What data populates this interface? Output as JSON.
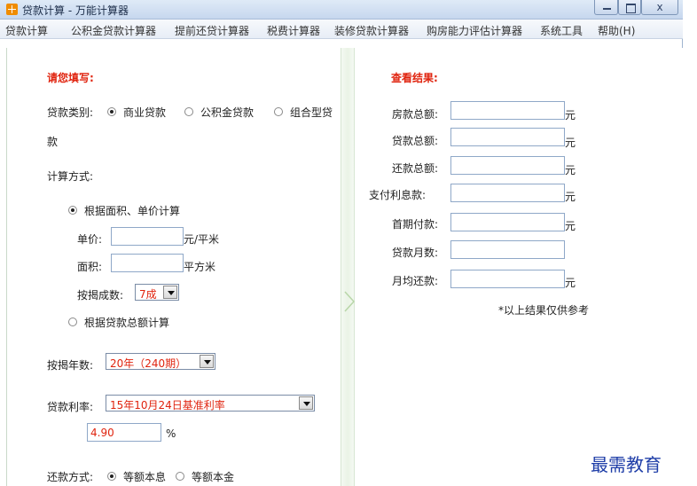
{
  "window": {
    "title": "贷款计算 - 万能计算器",
    "controls": {
      "close": "x"
    }
  },
  "menu": [
    "贷款计算",
    "公积金贷款计算器",
    "提前还贷计算器",
    "税费计算器",
    "装修贷款计算器",
    "购房能力评估计算器",
    "系统工具",
    "帮助(H)"
  ],
  "left": {
    "heading": "请您填写:",
    "loan_type": {
      "label": "贷款类别:",
      "options": [
        "商业贷款",
        "公积金贷款",
        "组合型贷款"
      ],
      "selected": "商业贷款",
      "wrap_tail": "款"
    },
    "calc_method": {
      "label": "计算方式:",
      "by_area": {
        "label": "根据面积、单价计算",
        "selected": true,
        "unit_price_label": "单价:",
        "unit_price_value": "",
        "unit_price_unit": "元/平米",
        "area_label": "面积:",
        "area_value": "",
        "area_unit": "平方米",
        "ratio_label": "按揭成数:",
        "ratio_value": "7成"
      },
      "by_total": {
        "label": "根据贷款总额计算",
        "selected": false
      }
    },
    "years": {
      "label": "按揭年数:",
      "value": "20年（240期）"
    },
    "rate": {
      "label": "贷款利率:",
      "value": "15年10月24日基准利率",
      "number": "4.90",
      "unit": "%"
    },
    "repay": {
      "label": "还款方式:",
      "options": [
        "等额本息",
        "等额本金"
      ],
      "selected": "等额本息"
    }
  },
  "right": {
    "heading": "查看结果:",
    "results": [
      {
        "label": "房款总额:",
        "value": "",
        "unit": "元"
      },
      {
        "label": "贷款总额:",
        "value": "",
        "unit": "元"
      },
      {
        "label": "还款总额:",
        "value": "",
        "unit": "元"
      },
      {
        "label": "支付利息款:",
        "value": "",
        "unit": "元"
      },
      {
        "label": "首期付款:",
        "value": "",
        "unit": "元"
      },
      {
        "label": "贷款月数:",
        "value": "",
        "unit": ""
      },
      {
        "label": "月均还款:",
        "value": "",
        "unit": "元"
      }
    ],
    "note": "*以上结果仅供参考"
  },
  "watermark": "最需教育"
}
